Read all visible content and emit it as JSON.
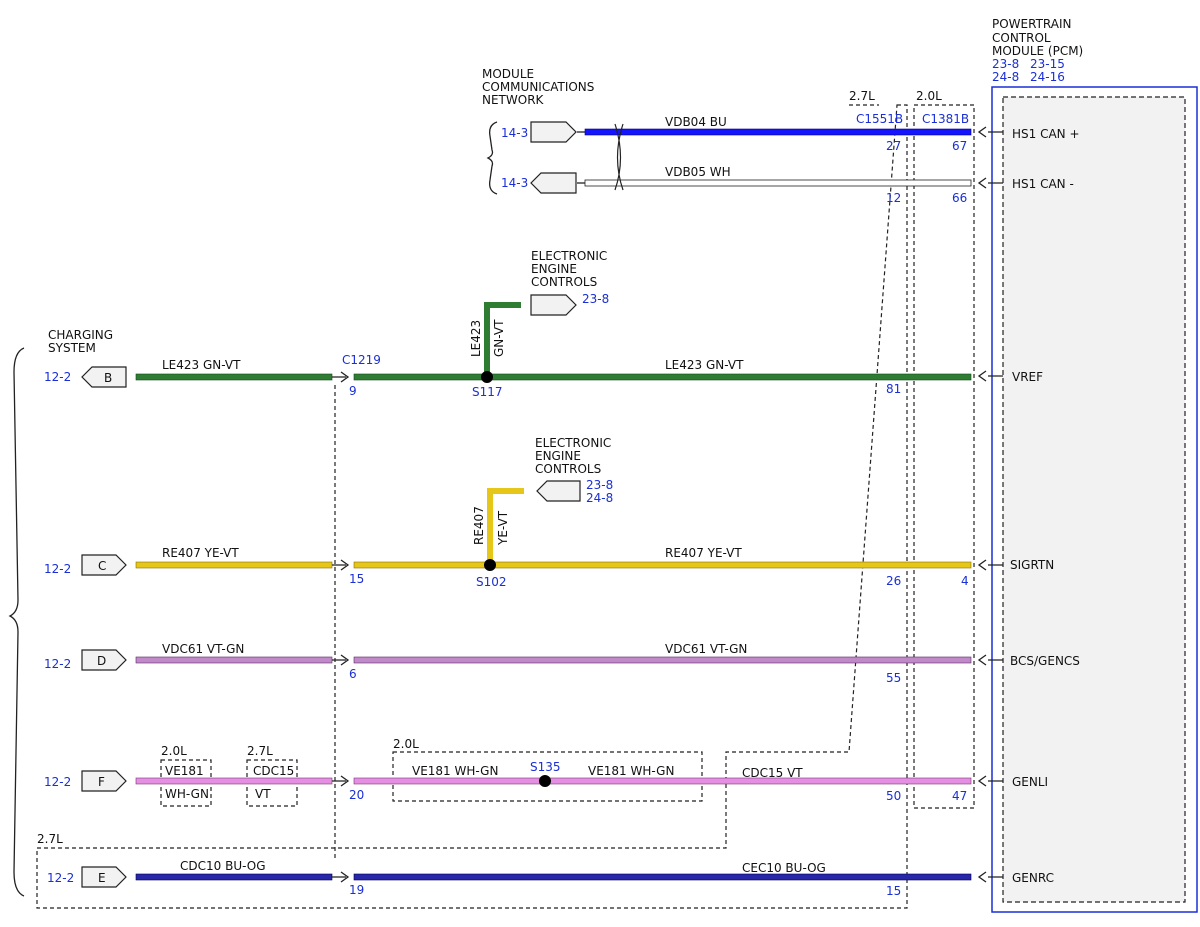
{
  "pcm": {
    "title_lines": [
      "POWERTRAIN",
      "CONTROL",
      "MODULE (PCM)"
    ],
    "refs": [
      "23-8",
      "23-15",
      "24-8",
      "24-16"
    ],
    "pins": [
      "HS1 CAN +",
      "HS1 CAN -",
      "VREF",
      "SIGRTN",
      "BCS/GENCS",
      "GENLI",
      "GENRC"
    ]
  },
  "mcn": {
    "title_lines": [
      "MODULE",
      "COMMUNICATIONS",
      "NETWORK"
    ],
    "ref1": "14-3",
    "ref2": "14-3"
  },
  "charging": {
    "title_lines": [
      "CHARGING",
      "SYSTEM"
    ]
  },
  "eec1": {
    "title_lines": [
      "ELECTRONIC",
      "ENGINE",
      "CONTROLS"
    ],
    "ref": "23-8"
  },
  "eec2": {
    "title_lines": [
      "ELECTRONIC",
      "ENGINE",
      "CONTROLS"
    ],
    "refs": [
      "23-8",
      "24-8"
    ]
  },
  "variants": {
    "c1551b_engine": "2.7L",
    "c1381b_engine": "2.0L",
    "ve181_box": "2.0L",
    "cdc15_box": "2.7L",
    "splice_box": "2.0L",
    "cdc10_box": "2.7L"
  },
  "connectors": {
    "c1551b": "C1551B",
    "c1381b": "C1381B",
    "c1219": "C1219"
  },
  "splices": {
    "s117": "S117",
    "s102": "S102",
    "s135": "S135"
  },
  "pins": {
    "c1551b": [
      "27",
      "12",
      "81",
      "26",
      "55",
      "50",
      "15"
    ],
    "c1381b": [
      "67",
      "66",
      "4",
      "47"
    ],
    "c1219": [
      "9",
      "15",
      "6",
      "20",
      "19"
    ]
  },
  "wires": {
    "can_plus": {
      "label": "VDB04  BU",
      "color": "#1414ff"
    },
    "can_minus": {
      "label": "VDB05  WH",
      "color": "#ffffff"
    },
    "vref_left": {
      "label": "LE423  GN-VT",
      "color": "#2e7d32"
    },
    "vref_right": {
      "label": "LE423  GN-VT",
      "color": "#2e7d32"
    },
    "vref_branch": {
      "circuit": "LE423",
      "color_code": "GN-VT"
    },
    "sigrtn_left": {
      "label": "RE407  YE-VT",
      "color": "#e6c619"
    },
    "sigrtn_right": {
      "label": "RE407   YE-VT",
      "color": "#e6c619"
    },
    "sigrtn_branch": {
      "circuit": "RE407",
      "color_code": "YE-VT"
    },
    "gencs_left": {
      "label": "VDC61  VT-GN",
      "color": "#c08ac9"
    },
    "gencs_right": {
      "label": "VDC61  VT-GN",
      "color": "#c08ac9"
    },
    "genli_ve181_box": {
      "circuit": "VE181",
      "color_code": "WH-GN"
    },
    "genli_cdc15_box": {
      "circuit": "CDC15",
      "color_code": "VT"
    },
    "genli_mid_left": {
      "label": "VE181   WH-GN"
    },
    "genli_mid_right": {
      "label": "VE181   WH-GN"
    },
    "genli_right": {
      "label": "CDC15  VT",
      "color": "#e58fe2"
    },
    "genrc_left": {
      "label": "CDC10  BU-OG",
      "color": "#2727a8"
    },
    "genrc_right": {
      "label": "CEC10  BU-OG",
      "color": "#2727a8"
    }
  },
  "sources": [
    {
      "ref": "12-2",
      "letter": "B"
    },
    {
      "ref": "12-2",
      "letter": "C"
    },
    {
      "ref": "12-2",
      "letter": "D"
    },
    {
      "ref": "12-2",
      "letter": "F"
    },
    {
      "ref": "12-2",
      "letter": "E"
    }
  ]
}
